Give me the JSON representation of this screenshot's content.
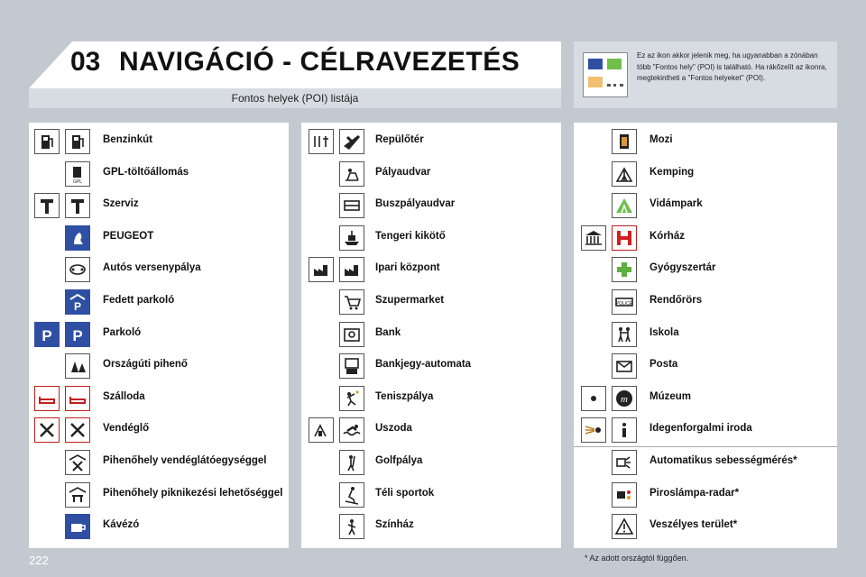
{
  "header": {
    "chapter_number": "03",
    "chapter_title": "NAVIGÁCIÓ - CÉLRAVEZETÉS",
    "subtitle": "Fontos helyek (POI) listája"
  },
  "info": {
    "text": "Ez az ikon akkor jelenik meg, ha ugyanabban a zónában több \"Fontos hely\" (POI) is található. Ha rákőzelít az ikonra, megtekintheti a \"Fontos helyeket\" (POI).",
    "colors": [
      "#2f4fa3",
      "#6fbf4a",
      "#f0c070",
      "#555555"
    ]
  },
  "columns": [
    {
      "items": [
        {
          "label": "Benzinkút",
          "icons": [
            "fuel-pump-icon",
            "fuel-pump-icon"
          ]
        },
        {
          "label": "GPL-töltőállomás",
          "icons": [
            "gpl-station-icon"
          ]
        },
        {
          "label": "Szerviz",
          "icons": [
            "wrench-icon",
            "wrench-icon"
          ]
        },
        {
          "label": "PEUGEOT",
          "icons": [
            "peugeot-lion-icon"
          ]
        },
        {
          "label": "Autós versenypálya",
          "icons": [
            "race-track-icon"
          ]
        },
        {
          "label": "Fedett parkoló",
          "icons": [
            "covered-parking-icon"
          ]
        },
        {
          "label": "Parkoló",
          "icons": [
            "parking-icon",
            "parking-icon"
          ]
        },
        {
          "label": "Országúti pihenő",
          "icons": [
            "rest-area-icon"
          ]
        },
        {
          "label": "Szálloda",
          "icons": [
            "bed-icon",
            "bed-icon"
          ]
        },
        {
          "label": "Vendéglő",
          "icons": [
            "fork-knife-icon",
            "fork-knife-icon"
          ]
        },
        {
          "label": "Pihenőhely vendéglátóegységgel",
          "icons": [
            "rest-restaurant-icon"
          ]
        },
        {
          "label": "Pihenőhely piknikezési lehetőséggel",
          "icons": [
            "rest-picnic-icon"
          ]
        },
        {
          "label": "Kávézó",
          "icons": [
            "coffee-cup-icon"
          ]
        }
      ]
    },
    {
      "items": [
        {
          "label": "Repülőtér",
          "icons": [
            "airport-services-icon",
            "airplane-icon"
          ]
        },
        {
          "label": "Pályaudvar",
          "icons": [
            "train-station-icon"
          ]
        },
        {
          "label": "Buszpályaudvar",
          "icons": [
            "bus-station-icon"
          ]
        },
        {
          "label": "Tengeri kikötő",
          "icons": [
            "ferry-port-icon"
          ]
        },
        {
          "label": "Ipari központ",
          "icons": [
            "industrial-zone-icon",
            "industrial-zone-icon"
          ]
        },
        {
          "label": "Szupermarket",
          "icons": [
            "shopping-cart-icon"
          ]
        },
        {
          "label": "Bank",
          "icons": [
            "bank-icon"
          ]
        },
        {
          "label": "Bankjegy-automata",
          "icons": [
            "atm-icon"
          ]
        },
        {
          "label": "Teniszpálya",
          "icons": [
            "tennis-icon"
          ]
        },
        {
          "label": "Uszoda",
          "icons": [
            "sport-center-icon",
            "swimming-icon"
          ]
        },
        {
          "label": "Golfpálya",
          "icons": [
            "golf-icon"
          ]
        },
        {
          "label": "Téli sportok",
          "icons": [
            "skiing-icon"
          ]
        },
        {
          "label": "Színház",
          "icons": [
            "theatre-icon"
          ]
        }
      ]
    },
    {
      "items": [
        {
          "label": "Mozi",
          "icons": [
            "cinema-film-icon"
          ]
        },
        {
          "label": "Kemping",
          "icons": [
            "tent-icon"
          ]
        },
        {
          "label": "Vidámpark",
          "icons": [
            "amusement-park-icon"
          ]
        },
        {
          "label": "Kórház",
          "icons": [
            "town-hall-icon",
            "hospital-icon"
          ]
        },
        {
          "label": "Gyógyszertár",
          "icons": [
            "pharmacy-cross-icon"
          ]
        },
        {
          "label": "Rendőrörs",
          "icons": [
            "police-icon"
          ]
        },
        {
          "label": "Iskola",
          "icons": [
            "school-children-icon"
          ]
        },
        {
          "label": "Posta",
          "icons": [
            "envelope-icon"
          ]
        },
        {
          "label": "Múzeum",
          "icons": [
            "monument-icon",
            "museum-icon"
          ]
        },
        {
          "label": "Idegenforgalmi iroda",
          "icons": [
            "tourist-icon",
            "info-icon"
          ]
        },
        {
          "label": "Automatikus sebességmérés*",
          "icons": [
            "speed-camera-icon"
          ]
        },
        {
          "label": "Piroslámpa-radar*",
          "icons": [
            "red-light-camera-icon"
          ]
        },
        {
          "label": "Veszélyes terület*",
          "icons": [
            "danger-zone-icon"
          ]
        }
      ]
    }
  ],
  "footer": {
    "page_number": "222",
    "footnote": "* Az adott országtól függően."
  }
}
